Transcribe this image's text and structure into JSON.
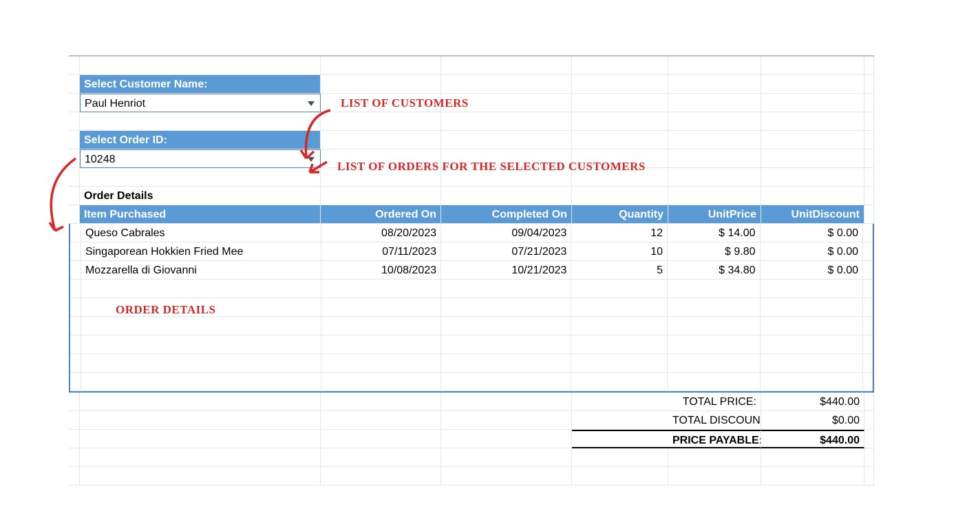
{
  "labels": {
    "select_customer": "Select Customer Name:",
    "select_order": "Select Order ID:",
    "order_details": "Order Details"
  },
  "inputs": {
    "customer_name": "Paul Henriot",
    "order_id": "10248"
  },
  "annotations": {
    "customers": "LIST  OF  CUSTOMERS",
    "orders": "LIST  OF  ORDERS  FOR  THE  SELECTED  CUSTOMERS",
    "details": "ORDER  DETAILS"
  },
  "table": {
    "headers": {
      "item": "Item Purchased",
      "ordered_on": "Ordered On",
      "completed_on": "Completed On",
      "quantity": "Quantity",
      "unitprice": "UnitPrice",
      "unitdiscount": "UnitDiscount"
    },
    "rows": [
      {
        "item": "Queso Cabrales",
        "ordered_on": "08/20/2023",
        "completed_on": "09/04/2023",
        "quantity": 12,
        "unitprice": "$ 14.00",
        "unitdiscount": "$ 0.00"
      },
      {
        "item": "Singaporean Hokkien Fried Mee",
        "ordered_on": "07/11/2023",
        "completed_on": "07/21/2023",
        "quantity": 10,
        "unitprice": "$ 9.80",
        "unitdiscount": "$ 0.00"
      },
      {
        "item": "Mozzarella di Giovanni",
        "ordered_on": "10/08/2023",
        "completed_on": "10/21/2023",
        "quantity": 5,
        "unitprice": "$ 34.80",
        "unitdiscount": "$ 0.00"
      }
    ]
  },
  "totals": {
    "total_price_label": "TOTAL PRICE:",
    "total_price": "$440.00",
    "total_discount_label": "TOTAL DISCOUNT:",
    "total_discount": "$0.00",
    "price_payable_label": "PRICE PAYABLE:",
    "price_payable": "$440.00"
  },
  "chart_data": {
    "type": "table",
    "title": "Order Details",
    "columns": [
      "Item Purchased",
      "Ordered On",
      "Completed On",
      "Quantity",
      "UnitPrice",
      "UnitDiscount"
    ],
    "rows": [
      [
        "Queso Cabrales",
        "08/20/2023",
        "09/04/2023",
        12,
        14.0,
        0.0
      ],
      [
        "Singaporean Hokkien Fried Mee",
        "07/11/2023",
        "07/21/2023",
        10,
        9.8,
        0.0
      ],
      [
        "Mozzarella di Giovanni",
        "10/08/2023",
        "10/21/2023",
        5,
        34.8,
        0.0
      ]
    ],
    "totals": {
      "total_price": 440.0,
      "total_discount": 0.0,
      "price_payable": 440.0
    }
  }
}
